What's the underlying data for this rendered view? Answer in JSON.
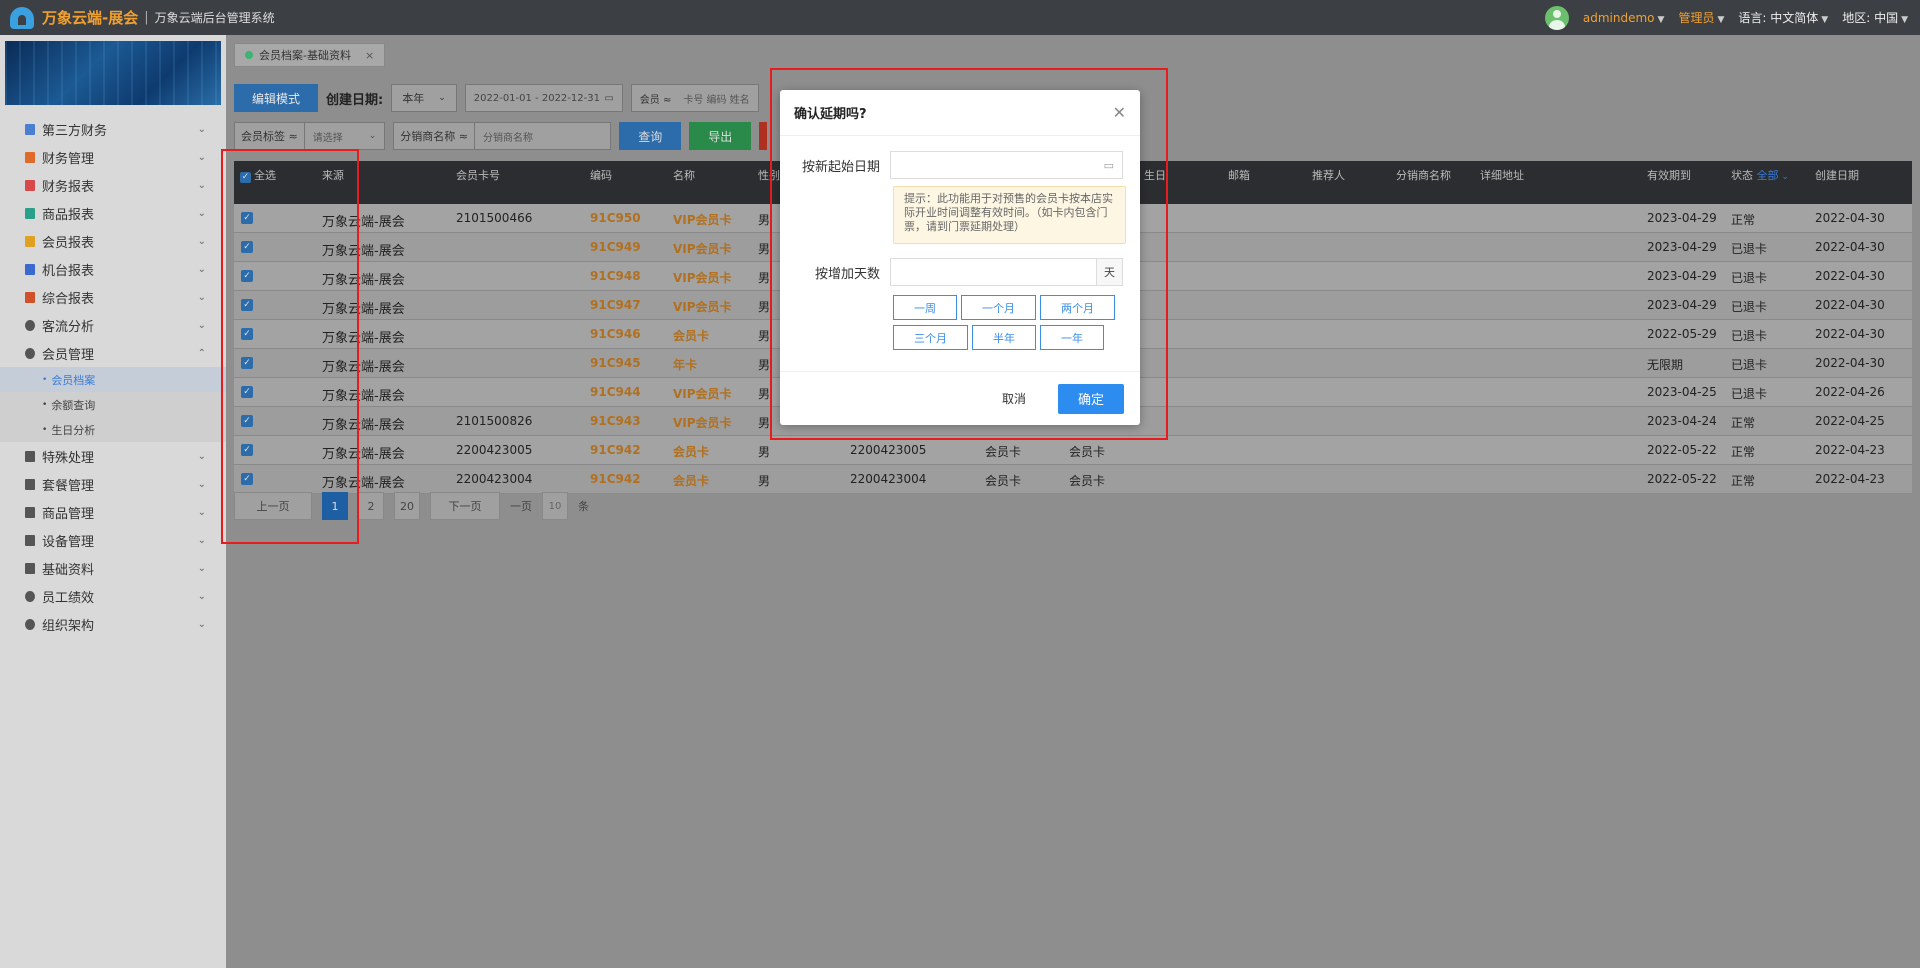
{
  "header": {
    "brand": "万象云端-展会",
    "separator": "|",
    "subtitle": "万象云端后台管理系统",
    "user": "admindemo",
    "role": "管理员",
    "language_label": "语言:",
    "language_value": "中文简体",
    "region_label": "地区:",
    "region_value": "中国"
  },
  "sidebar": {
    "items": [
      {
        "label": "第三方财务",
        "color": "#4a7ed0"
      },
      {
        "label": "财务管理",
        "color": "#e06a2a"
      },
      {
        "label": "财务报表",
        "color": "#d84a4a"
      },
      {
        "label": "商品报表",
        "color": "#2aa08a"
      },
      {
        "label": "会员报表",
        "color": "#e0a020"
      },
      {
        "label": "机台报表",
        "color": "#3a6ad0"
      },
      {
        "label": "综合报表",
        "color": "#d0502a"
      },
      {
        "label": "客流分析",
        "color": "#555"
      },
      {
        "label": "会员管理",
        "color": "#555"
      }
    ],
    "submenu": [
      {
        "label": "会员档案",
        "active": true
      },
      {
        "label": "余额查询",
        "active": false
      },
      {
        "label": "生日分析",
        "active": false
      }
    ],
    "items_after": [
      {
        "label": "特殊处理",
        "color": "#555"
      },
      {
        "label": "套餐管理",
        "color": "#555"
      },
      {
        "label": "商品管理",
        "color": "#555"
      },
      {
        "label": "设备管理",
        "color": "#555"
      },
      {
        "label": "基础资料",
        "color": "#555"
      },
      {
        "label": "员工绩效",
        "color": "#555"
      },
      {
        "label": "组织架构",
        "color": "#555"
      }
    ]
  },
  "tab": {
    "label": "会员档案-基础资料",
    "close": "×"
  },
  "toolbar": {
    "edit_mode": "编辑模式",
    "create_date_label": "创建日期:",
    "period_value": "本年",
    "date_range": "2022-01-01 - 2022-12-31",
    "member_label": "会员 ≈",
    "member_placeholder": "卡号 编码 姓名",
    "tag_label": "会员标签 ≈",
    "tag_placeholder": "请选择",
    "distributor_label": "分销商名称 ≈",
    "distributor_placeholder": "分销商名称",
    "query": "查询",
    "export": "导出"
  },
  "table": {
    "select_all": "全选",
    "columns": [
      "来源",
      "会员卡号",
      "编码",
      "名称",
      "性别",
      "生日",
      "邮箱",
      "推荐人",
      "分销商名称",
      "详细地址",
      "有效期到",
      "状态",
      "全部",
      "创建日期"
    ],
    "rows": [
      {
        "source": "万象云端-展会",
        "card_no": "2101500466",
        "code": "91C950",
        "name": "VIP会员卡",
        "gender": "男",
        "phone": "",
        "type": "",
        "type2": "",
        "expire": "2023-04-29",
        "status": "正常",
        "created": "2022-04-30"
      },
      {
        "source": "万象云端-展会",
        "card_no": "",
        "code": "91C949",
        "name": "VIP会员卡",
        "gender": "男",
        "phone": "",
        "type": "",
        "type2": "",
        "expire": "2023-04-29",
        "status": "已退卡",
        "created": "2022-04-30"
      },
      {
        "source": "万象云端-展会",
        "card_no": "",
        "code": "91C948",
        "name": "VIP会员卡",
        "gender": "男",
        "phone": "",
        "type": "",
        "type2": "",
        "expire": "2023-04-29",
        "status": "已退卡",
        "created": "2022-04-30"
      },
      {
        "source": "万象云端-展会",
        "card_no": "",
        "code": "91C947",
        "name": "VIP会员卡",
        "gender": "男",
        "phone": "",
        "type": "",
        "type2": "",
        "expire": "2023-04-29",
        "status": "已退卡",
        "created": "2022-04-30"
      },
      {
        "source": "万象云端-展会",
        "card_no": "",
        "code": "91C946",
        "name": "会员卡",
        "gender": "男",
        "phone": "",
        "type": "",
        "type2": "",
        "expire": "2022-05-29",
        "status": "已退卡",
        "created": "2022-04-30"
      },
      {
        "source": "万象云端-展会",
        "card_no": "",
        "code": "91C945",
        "name": "年卡",
        "gender": "男",
        "phone": "",
        "type": "",
        "type2": "",
        "expire": "无限期",
        "status": "已退卡",
        "created": "2022-04-30"
      },
      {
        "source": "万象云端-展会",
        "card_no": "",
        "code": "91C944",
        "name": "VIP会员卡",
        "gender": "男",
        "phone": "",
        "type": "",
        "type2": "",
        "expire": "2023-04-25",
        "status": "已退卡",
        "created": "2022-04-26"
      },
      {
        "source": "万象云端-展会",
        "card_no": "2101500826",
        "code": "91C943",
        "name": "VIP会员卡",
        "gender": "男",
        "phone": "",
        "type": "",
        "type2": "",
        "expire": "2023-04-24",
        "status": "正常",
        "created": "2022-04-25"
      },
      {
        "source": "万象云端-展会",
        "card_no": "2200423005",
        "code": "91C942",
        "name": "会员卡",
        "gender": "男",
        "phone": "2200423005",
        "type": "会员卡",
        "type2": "会员卡",
        "expire": "2022-05-22",
        "status": "正常",
        "created": "2022-04-23"
      },
      {
        "source": "万象云端-展会",
        "card_no": "2200423004",
        "code": "91C942",
        "name": "会员卡",
        "gender": "男",
        "phone": "2200423004",
        "type": "会员卡",
        "type2": "会员卡",
        "expire": "2022-05-22",
        "status": "正常",
        "created": "2022-04-23"
      }
    ]
  },
  "pager": {
    "prev": "上一页",
    "pages": [
      "1",
      "2",
      "20"
    ],
    "next": "下一页",
    "per_label": "一页",
    "per_value": "10",
    "unit": "条"
  },
  "modal": {
    "title": "确认延期吗?",
    "start_label": "按新起始日期",
    "tip": "提示：此功能用于对预售的会员卡按本店实际开业时间调整有效时间。（如卡内包含门票，请到门票延期处理）",
    "days_label": "按增加天数",
    "days_unit": "天",
    "quick": [
      "一周",
      "一个月",
      "两个月",
      "三个月",
      "半年",
      "一年"
    ],
    "cancel": "取消",
    "ok": "确定"
  }
}
